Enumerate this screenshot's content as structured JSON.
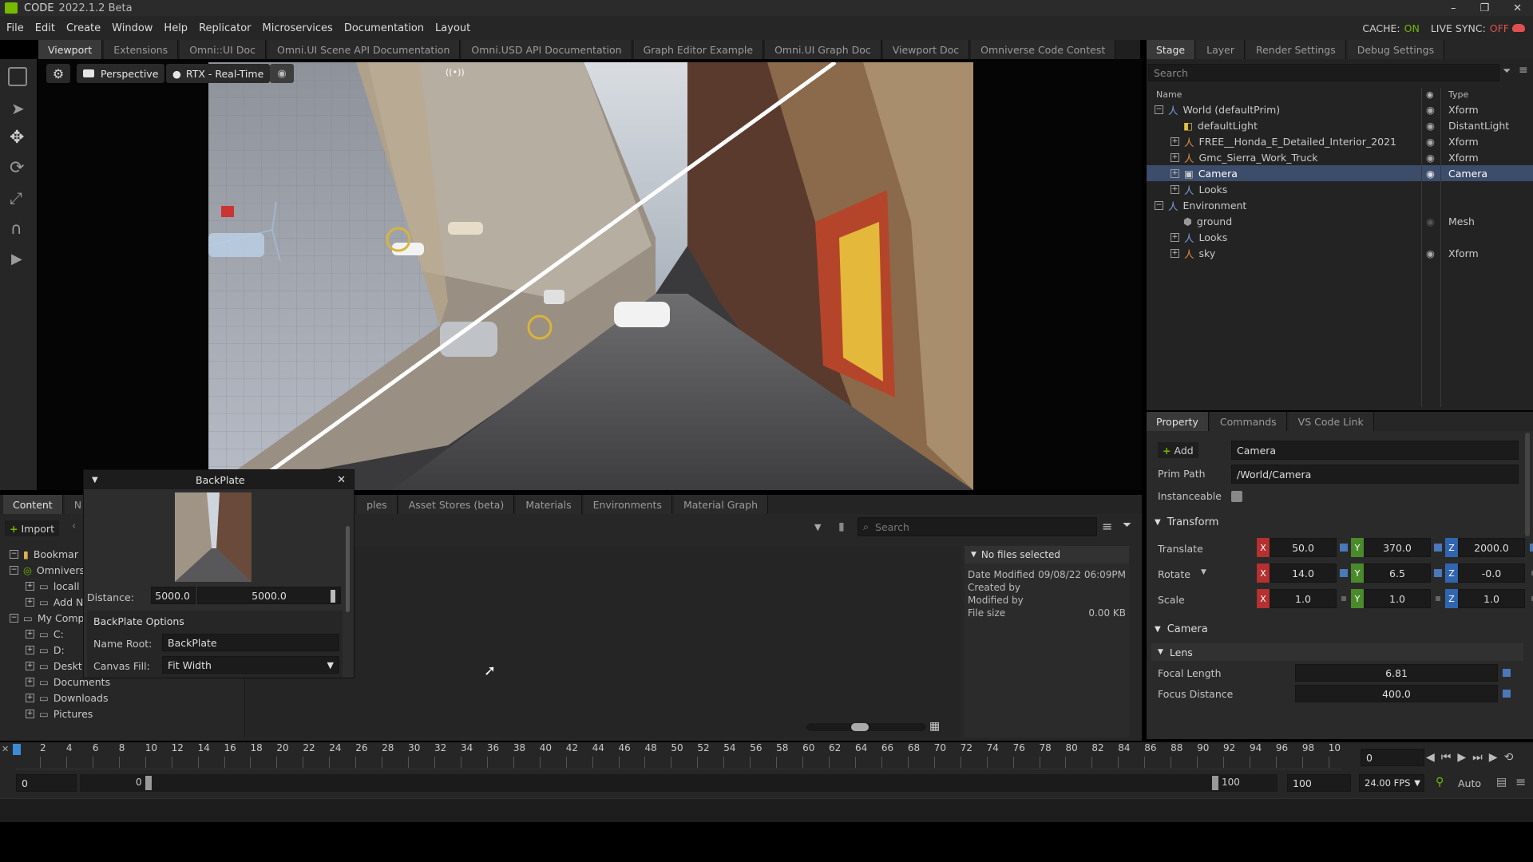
{
  "titlebar": {
    "app_name": "CODE",
    "version": "2022.1.2 Beta",
    "min_glyph": "–",
    "max_glyph": "❐",
    "close_glyph": "✕"
  },
  "menubar": {
    "items": [
      "File",
      "Edit",
      "Create",
      "Window",
      "Help",
      "Replicator",
      "Microservices",
      "Documentation",
      "Layout"
    ],
    "cache_label": "CACHE:",
    "cache_value": "ON",
    "live_sync_label": "LIVE SYNC:",
    "live_sync_value": "OFF"
  },
  "main_tabs": [
    "Viewport",
    "Extensions",
    "Omni::UI Doc",
    "Omni.UI Scene API Documentation",
    "Omni.USD API Documentation",
    "Graph Editor Example",
    "Omni.UI Graph Doc",
    "Viewport Doc",
    "Omniverse Code Contest"
  ],
  "viewport": {
    "camera_label": "Perspective",
    "renderer_label": "RTX - Real-Time",
    "signal_glyph": "((•))"
  },
  "right_tabs": [
    "Stage",
    "Layer",
    "Render Settings",
    "Debug Settings"
  ],
  "stage": {
    "search_placeholder": "Search",
    "col_name": "Name",
    "col_type": "Type",
    "rows": [
      {
        "name": "World (defaultPrim)",
        "type": "Xform"
      },
      {
        "name": "defaultLight",
        "type": "DistantLight"
      },
      {
        "name": "FREE__Honda_E_Detailed_Interior_2021",
        "type": "Xform"
      },
      {
        "name": "Gmc_Sierra_Work_Truck",
        "type": "Xform"
      },
      {
        "name": "Camera",
        "type": "Camera"
      },
      {
        "name": "Looks",
        "type": ""
      },
      {
        "name": "Environment",
        "type": ""
      },
      {
        "name": "ground",
        "type": "Mesh"
      },
      {
        "name": "Looks",
        "type": ""
      },
      {
        "name": "sky",
        "type": "Xform"
      }
    ]
  },
  "property_tabs": [
    "Property",
    "Commands",
    "VS Code Link"
  ],
  "property": {
    "add_label": "Add",
    "prim_name": "Camera",
    "prim_path_label": "Prim Path",
    "prim_path": "/World/Camera",
    "instanceable_label": "Instanceable",
    "transform_header": "Transform",
    "translate_label": "Translate",
    "rotate_label": "Rotate",
    "scale_label": "Scale",
    "translate": [
      "50.0",
      "370.0",
      "2000.0"
    ],
    "rotate": [
      "14.0",
      "6.5",
      "-0.0"
    ],
    "scale": [
      "1.0",
      "1.0",
      "1.0"
    ],
    "axis_x": "X",
    "axis_y": "Y",
    "axis_z": "Z",
    "camera_header": "Camera",
    "lens_header": "Lens",
    "focal_length_label": "Focal Length",
    "focal_length": "6.81",
    "focus_distance_label": "Focus Distance",
    "focus_distance": "400.0"
  },
  "content_tabs": [
    "Content",
    "N",
    "ples",
    "Asset Stores (beta)",
    "Materials",
    "Environments",
    "Material Graph"
  ],
  "content": {
    "import_label": "Import",
    "search_placeholder": "Search",
    "tree": [
      {
        "label": "Bookmar",
        "indent": 0,
        "icon": "folder-icon"
      },
      {
        "label": "Omnivers",
        "indent": 0,
        "icon": "omniverse-icon"
      },
      {
        "label": "locall",
        "indent": 1,
        "icon": "server-icon"
      },
      {
        "label": "Add N",
        "indent": 1,
        "icon": "server-icon"
      },
      {
        "label": "My Comp",
        "indent": 0,
        "icon": "computer-icon"
      },
      {
        "label": "C:",
        "indent": 1,
        "icon": "drive-icon"
      },
      {
        "label": "D:",
        "indent": 1,
        "icon": "drive-icon"
      },
      {
        "label": "Deskt",
        "indent": 1,
        "icon": "drive-icon"
      },
      {
        "label": "Documents",
        "indent": 1,
        "icon": "drive-icon"
      },
      {
        "label": "Downloads",
        "indent": 1,
        "icon": "drive-icon"
      },
      {
        "label": "Pictures",
        "indent": 1,
        "icon": "drive-icon"
      }
    ],
    "details": {
      "header": "No files selected",
      "date_modified_label": "Date Modified",
      "date_modified": "09/08/22 06:09PM",
      "created_by_label": "Created by",
      "modified_by_label": "Modified by",
      "file_size_label": "File size",
      "file_size": "0.00 KB"
    }
  },
  "backplate": {
    "title": "BackPlate",
    "distance_label": "Distance:",
    "distance_value": "5000.0",
    "distance_slider": "5000.0",
    "options_header": "BackPlate Options",
    "name_root_label": "Name Root:",
    "name_root": "BackPlate",
    "canvas_fill_label": "Canvas Fill:",
    "canvas_fill": "Fit Width"
  },
  "timeline": {
    "ticks": [
      "2",
      "4",
      "6",
      "8",
      "10",
      "12",
      "14",
      "16",
      "18",
      "20",
      "22",
      "24",
      "26",
      "28",
      "30",
      "32",
      "34",
      "36",
      "38",
      "40",
      "42",
      "44",
      "46",
      "48",
      "50",
      "52",
      "54",
      "56",
      "58",
      "60",
      "62",
      "64",
      "66",
      "68",
      "70",
      "72",
      "74",
      "76",
      "78",
      "80",
      "82",
      "84",
      "86",
      "88",
      "90",
      "92",
      "94",
      "96",
      "98",
      "10"
    ],
    "current_frame": "0",
    "start": "0",
    "range_start": "0",
    "range_end": "100",
    "end": "100",
    "fps": "24.00 FPS",
    "auto_label": "Auto"
  },
  "colors": {
    "accent_green": "#76b900",
    "axis_x": "#b53030",
    "axis_y": "#4a8a2a",
    "axis_z": "#3066b0",
    "selection": "#3c4c6b"
  }
}
